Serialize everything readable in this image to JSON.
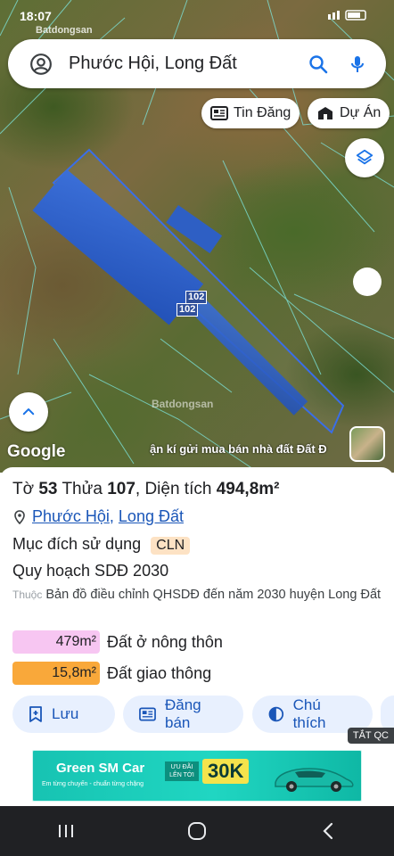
{
  "status_bar": {
    "time": "18:07",
    "watermark": "Batdongsan"
  },
  "search": {
    "query": "Phước Hội, Long Đất"
  },
  "map": {
    "chips": [
      {
        "label": "Tin Đăng",
        "icon": "newspaper-icon"
      },
      {
        "label": "Dự Án",
        "icon": "building-icon"
      }
    ],
    "parcel_labels": [
      "102",
      "102"
    ],
    "watermark": "Batdongsan",
    "google_logo": "Google",
    "ad_text": "ận kí gửi mua bán nhà đất Đất Đ"
  },
  "panel": {
    "title": {
      "to_label": "Tờ",
      "to_value": "53",
      "thua_label": "Thửa",
      "thua_value": "107",
      "area_label": "Diện tích",
      "area_value": "494,8m²"
    },
    "address": {
      "ward": "Phước Hội",
      "separator": ",",
      "district": "Long Đất"
    },
    "purpose": {
      "label": "Mục đích sử dụng",
      "code": "CLN"
    },
    "plan": {
      "label": "Quy hoạch SDĐ 2030"
    },
    "belongs": {
      "prefix": "Thuộc",
      "text": "Bản đồ điều chỉnh QHSDĐ đến năm 2030 huyện Long Đất"
    },
    "land_uses": [
      {
        "value": "479m²",
        "label": "Đất ở nông thôn",
        "color": "#f7c6f2"
      },
      {
        "value": "15,8m²",
        "label": "Đất giao thông",
        "color": "#f9a83a"
      }
    ],
    "actions": {
      "save": "Lưu",
      "post": "Đăng bán",
      "legend": "Chú thích"
    },
    "hide_ad": "TẮT QC"
  },
  "ad_banner": {
    "brand": "Green SM Car",
    "tagline": "Em từng chuyến - chuẩn từng chặng",
    "deal": "ƯU ĐÃI LÊN TỚI",
    "amount": "30K"
  }
}
